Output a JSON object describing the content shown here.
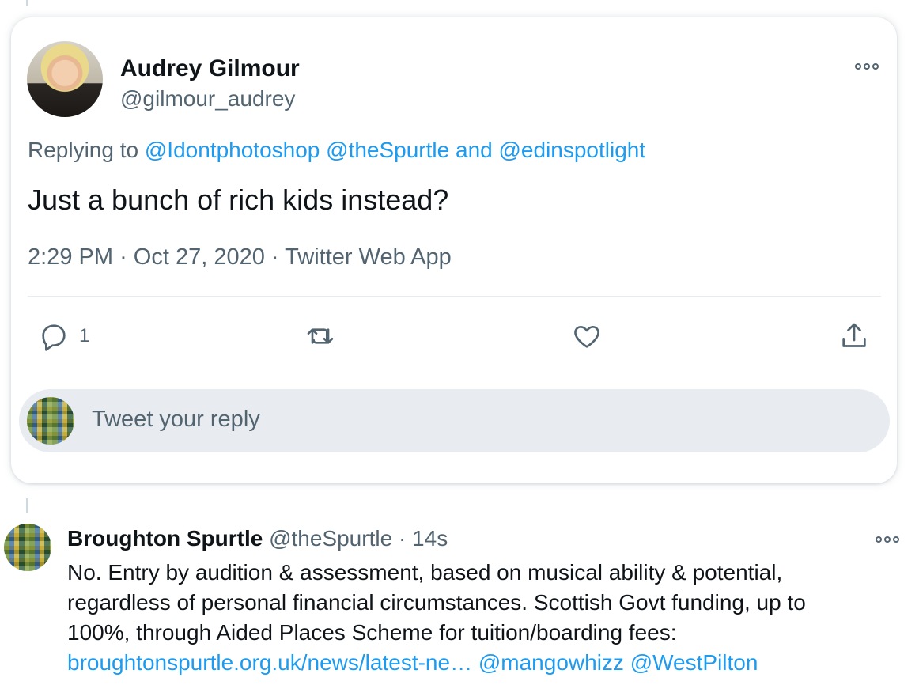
{
  "tweet": {
    "author_name": "Audrey Gilmour",
    "author_handle": "@gilmour_audrey",
    "replying_prefix": "Replying to",
    "replying_to_1": "@Idontphotoshop",
    "replying_to_2": "@theSpurtle",
    "replying_and": "and",
    "replying_to_3": "@edinspotlight",
    "text": "Just a bunch of rich kids instead?",
    "time": "2:29 PM",
    "meta_sep": "·",
    "date": "Oct 27, 2020",
    "source": "Twitter Web App",
    "reply_count": "1",
    "icons": [
      "reply-icon",
      "retweet-icon",
      "like-icon",
      "share-icon",
      "more-icon"
    ]
  },
  "composer": {
    "placeholder": "Tweet your reply"
  },
  "reply_tweet": {
    "author_name": "Broughton Spurtle",
    "author_handle": "@theSpurtle",
    "sep": "·",
    "time_ago": "14s",
    "text_line_1": "No. Entry by audition & assessment, based on musical ability & potential,",
    "text_line_2": "regardless of personal financial circumstances. Scottish Govt funding, up to",
    "text_line_3": "100%, through Aided Places Scheme for tuition/boarding fees:",
    "link": "broughtonspurtle.org.uk/news/latest-ne…",
    "mention_1": "@mangowhizz",
    "mention_2": "@WestPilton"
  },
  "colors": {
    "link": "#1d9bf0",
    "muted": "#536471",
    "text": "#0f1419",
    "composer_bg": "#e8ecf0"
  }
}
